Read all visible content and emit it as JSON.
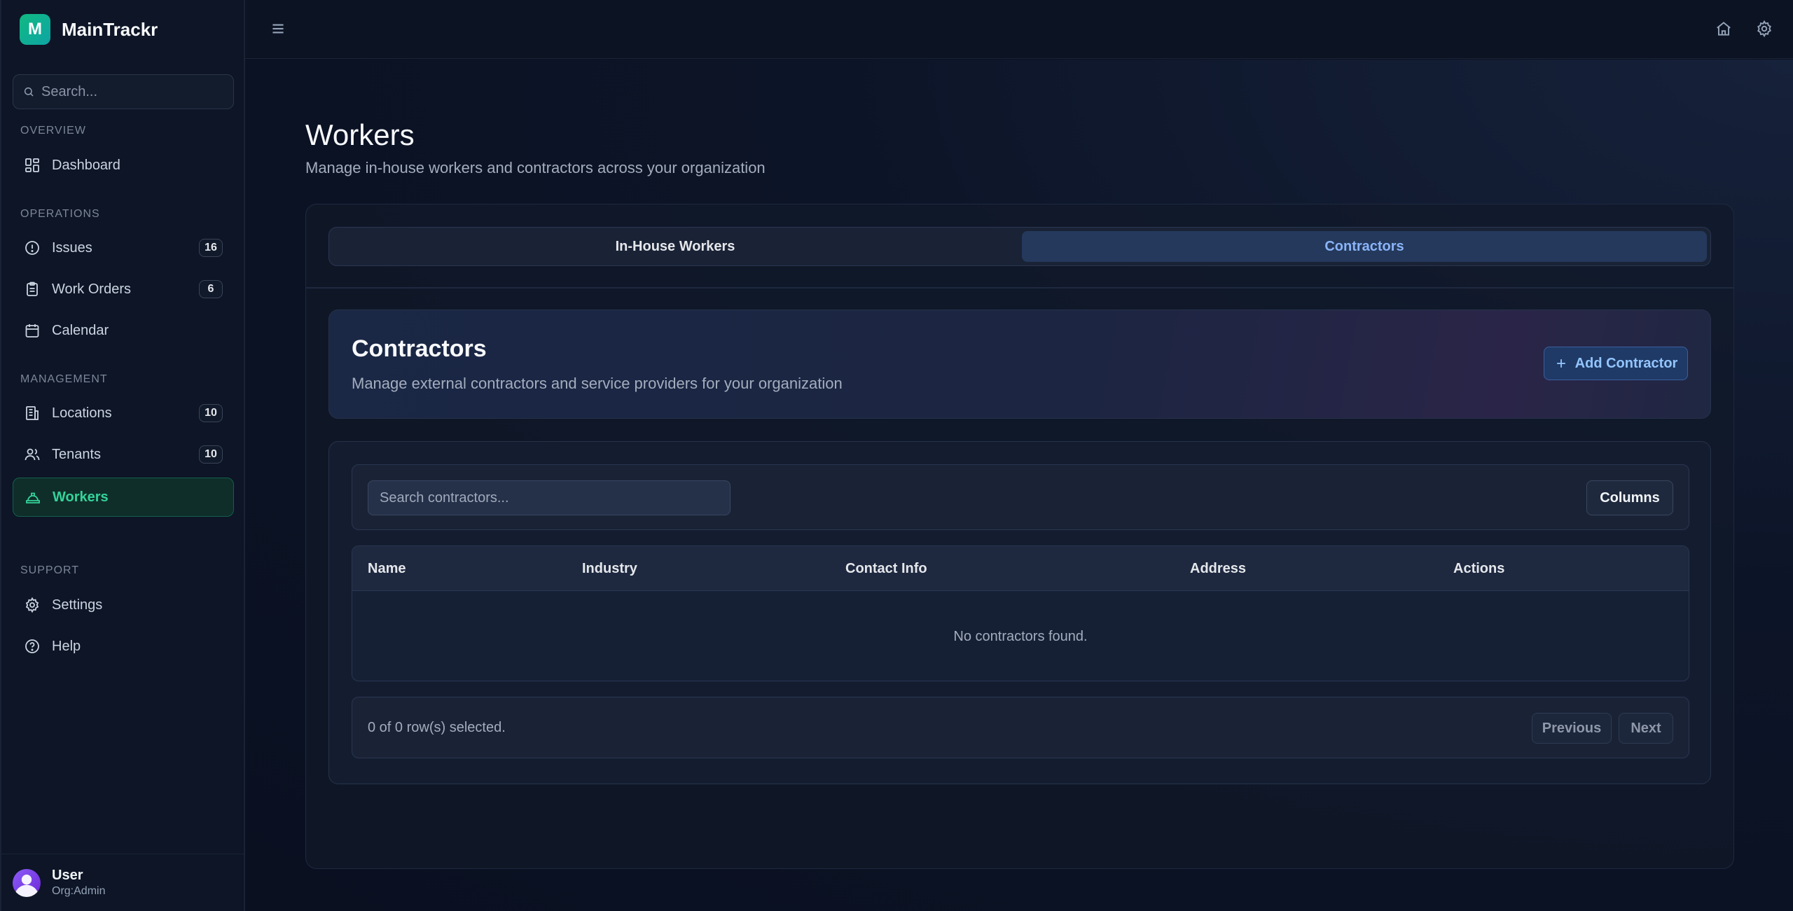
{
  "app": {
    "name": "MainTrackr",
    "logo_letter": "M"
  },
  "sidebar": {
    "search_placeholder": "Search...",
    "sections": {
      "overview": "OVERVIEW",
      "operations": "OPERATIONS",
      "management": "MANAGEMENT",
      "support": "SUPPORT"
    },
    "items": {
      "dashboard": {
        "label": "Dashboard"
      },
      "issues": {
        "label": "Issues",
        "badge": "16"
      },
      "work_orders": {
        "label": "Work Orders",
        "badge": "6"
      },
      "calendar": {
        "label": "Calendar"
      },
      "locations": {
        "label": "Locations",
        "badge": "10"
      },
      "tenants": {
        "label": "Tenants",
        "badge": "10"
      },
      "workers": {
        "label": "Workers",
        "active": true
      },
      "settings": {
        "label": "Settings"
      },
      "help": {
        "label": "Help"
      }
    },
    "user": {
      "name": "User",
      "role": "Org:Admin"
    }
  },
  "page": {
    "title": "Workers",
    "subtitle": "Manage in-house workers and contractors across your organization"
  },
  "tabs": [
    {
      "label": "In-House Workers",
      "active": false
    },
    {
      "label": "Contractors",
      "active": true
    }
  ],
  "contractors": {
    "title": "Contractors",
    "subtitle": "Manage external contractors and service providers for your organization",
    "add_button": "Add Contractor",
    "search_placeholder": "Search contractors...",
    "columns_button": "Columns",
    "table_headers": [
      "Name",
      "Industry",
      "Contact Info",
      "Address",
      "Actions"
    ],
    "empty_message": "No contractors found.",
    "selection_status": "0 of 0 row(s) selected.",
    "prev_button": "Previous",
    "next_button": "Next"
  },
  "colors": {
    "accent_green": "#34d399",
    "accent_blue": "#8ab4f8",
    "background": "#0b1120"
  }
}
